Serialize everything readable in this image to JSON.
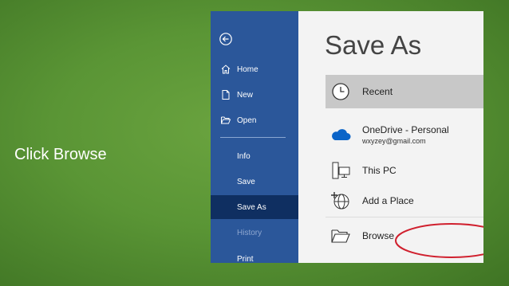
{
  "slide": {
    "caption": "Click Browse"
  },
  "sidebar": {
    "back_icon": "back-arrow-icon",
    "items": [
      {
        "label": "Home",
        "icon": "home-icon"
      },
      {
        "label": "New",
        "icon": "new-document-icon"
      },
      {
        "label": "Open",
        "icon": "open-folder-icon"
      },
      {
        "label": "Info"
      },
      {
        "label": "Save"
      },
      {
        "label": "Save As",
        "active": true
      },
      {
        "label": "History",
        "disabled": true
      },
      {
        "label": "Print"
      }
    ]
  },
  "main": {
    "title": "Save As",
    "locations": [
      {
        "label": "Recent",
        "icon": "clock-icon",
        "selected": true
      },
      {
        "label": "OneDrive - Personal",
        "sublabel": "wxyzey@gmail.com",
        "icon": "cloud-icon"
      },
      {
        "label": "This PC",
        "icon": "computer-icon"
      },
      {
        "label": "Add a Place",
        "icon": "globe-plus-icon"
      },
      {
        "label": "Browse",
        "icon": "folder-icon"
      }
    ]
  },
  "colors": {
    "sidebar": "#2b579a",
    "sidebar_active": "#0f2f61",
    "highlight": "#d0202e",
    "background_green": "#5a9535"
  }
}
